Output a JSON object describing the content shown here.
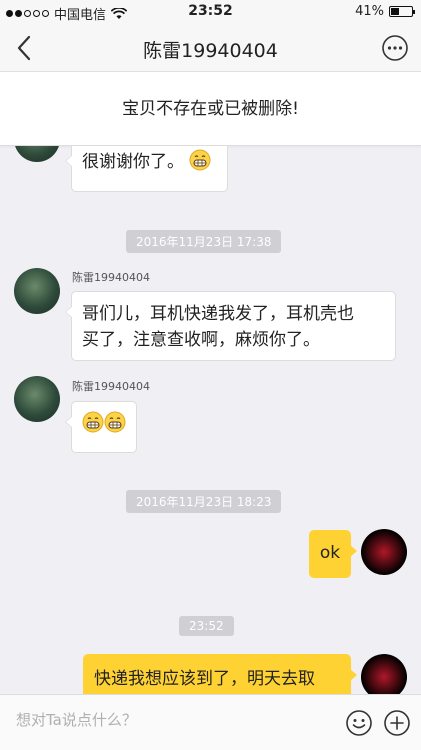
{
  "status_bar": {
    "carrier": "中国电信",
    "time": "23:52",
    "battery": "41%",
    "battery_level": 0.41
  },
  "nav": {
    "title": "陈雷19940404",
    "back_icon": "chevron-left-icon",
    "more_icon": "more-dots-icon"
  },
  "notice": {
    "text": "宝贝不存在或已被删除!"
  },
  "messages": {
    "m0": {
      "text": "很谢谢你了。"
    },
    "ts1": {
      "text": "2016年11月23日 17:38"
    },
    "m1": {
      "sender": "陈雷19940404",
      "text_line1": "哥们儿，耳机快递我发了，耳机壳也",
      "text_line2": "买了，注意查收啊，麻烦你了。"
    },
    "m2": {
      "sender": "陈雷19940404"
    },
    "ts2": {
      "text": "2016年11月23日 18:23"
    },
    "m3": {
      "text": "ok"
    },
    "ts3": {
      "text": "23:52"
    },
    "m4": {
      "text": "快递我想应该到了，明天去取"
    }
  },
  "input": {
    "placeholder": "想对Ta说点什么？",
    "emoji_icon": "smiley-icon",
    "plus_icon": "plus-circle-icon"
  },
  "colors": {
    "my_bubble": "#ffd233",
    "background": "#efeff4"
  }
}
